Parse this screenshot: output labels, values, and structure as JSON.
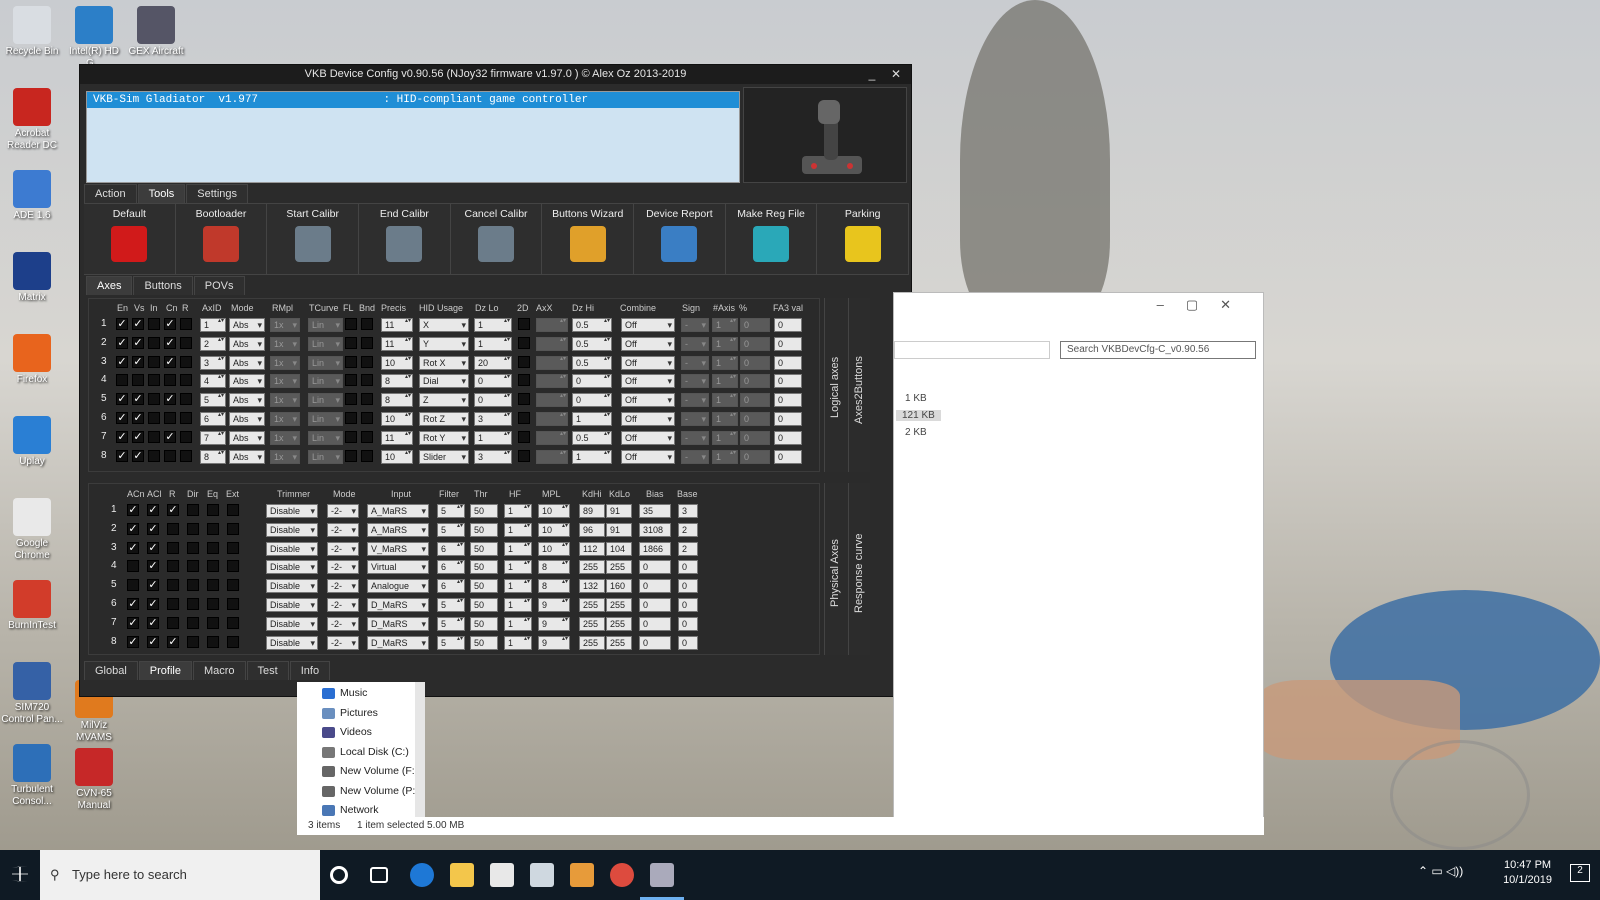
{
  "desktop": {
    "icons_col1": [
      "Recycle Bin",
      "Acrobat Reader DC",
      "ADE 1.6",
      "Matrix",
      "Firefox",
      "Uplay",
      "Google Chrome",
      "BurnInTest",
      "SIM720 Control Pan...",
      "Turbulent Consol..."
    ],
    "icons_col2": [
      "Intel(R) HD G...",
      "GEX Aircraft",
      "MilViz MVAMS",
      "CVN-65 Manual"
    ]
  },
  "vkb": {
    "title": "VKB Device Config v0.90.56 (NJoy32 firmware v1.97.0 ) © Alex Oz 2013-2019",
    "minimize": "_",
    "close": "✕",
    "device_row": "VKB-Sim Gladiator  v1.977                   : HID-compliant game controller",
    "top_tabs": [
      "Action",
      "Tools",
      "Settings"
    ],
    "tools": [
      "Default",
      "Bootloader",
      "Start Calibr",
      "End Calibr",
      "Cancel Calibr",
      "Buttons Wizard",
      "Device Report",
      "Make Reg File",
      "Parking"
    ],
    "sub_tabs": [
      "Axes",
      "Buttons",
      "POVs"
    ],
    "logical": {
      "headers": [
        "En",
        "Vs",
        "In",
        "Cn",
        "R",
        "AxID",
        "Mode",
        "RMpl",
        "TCurve",
        "FL",
        "Bnd",
        "Precis",
        "HID Usage",
        "Dz Lo",
        "2D",
        "AxX",
        "Dz Hi",
        "Combine",
        "Sign",
        "#Axis",
        "%",
        "FA3 val"
      ],
      "side_labels": [
        "Logical axes",
        "Axes2Buttons"
      ],
      "rows": [
        {
          "n": "1",
          "en": "✓",
          "vs": "✓",
          "in": "",
          "cn": "✓",
          "r": "",
          "axid": "1",
          "mode": "Abs",
          "rmpl": "1x",
          "tcurve": "Lin",
          "precis": "11",
          "hid": "X",
          "dzlo": "1",
          "dzhi": "0.5",
          "combine": "Off",
          "sign": "-",
          "axis": "1",
          "pct": "0",
          "fa3": "0"
        },
        {
          "n": "2",
          "en": "✓",
          "vs": "✓",
          "in": "",
          "cn": "✓",
          "r": "",
          "axid": "2",
          "mode": "Abs",
          "rmpl": "1x",
          "tcurve": "Lin",
          "precis": "11",
          "hid": "Y",
          "dzlo": "1",
          "dzhi": "0.5",
          "combine": "Off",
          "sign": "-",
          "axis": "1",
          "pct": "0",
          "fa3": "0"
        },
        {
          "n": "3",
          "en": "✓",
          "vs": "✓",
          "in": "",
          "cn": "✓",
          "r": "",
          "axid": "3",
          "mode": "Abs",
          "rmpl": "1x",
          "tcurve": "Lin",
          "precis": "10",
          "hid": "Rot X",
          "dzlo": "20",
          "dzhi": "0.5",
          "combine": "Off",
          "sign": "-",
          "axis": "1",
          "pct": "0",
          "fa3": "0"
        },
        {
          "n": "4",
          "en": "",
          "vs": "",
          "in": "",
          "cn": "",
          "r": "",
          "axid": "4",
          "mode": "Abs",
          "rmpl": "1x",
          "tcurve": "Lin",
          "precis": "8",
          "hid": "Dial",
          "dzlo": "0",
          "dzhi": "0",
          "combine": "Off",
          "sign": "-",
          "axis": "1",
          "pct": "0",
          "fa3": "0"
        },
        {
          "n": "5",
          "en": "✓",
          "vs": "✓",
          "in": "",
          "cn": "✓",
          "r": "",
          "axid": "5",
          "mode": "Abs",
          "rmpl": "1x",
          "tcurve": "Lin",
          "precis": "8",
          "hid": "Z",
          "dzlo": "0",
          "dzhi": "0",
          "combine": "Off",
          "sign": "-",
          "axis": "1",
          "pct": "0",
          "fa3": "0"
        },
        {
          "n": "6",
          "en": "✓",
          "vs": "✓",
          "in": "",
          "cn": "",
          "r": "",
          "axid": "6",
          "mode": "Abs",
          "rmpl": "1x",
          "tcurve": "Lin",
          "precis": "10",
          "hid": "Rot Z",
          "dzlo": "3",
          "dzhi": "1",
          "combine": "Off",
          "sign": "-",
          "axis": "1",
          "pct": "0",
          "fa3": "0"
        },
        {
          "n": "7",
          "en": "✓",
          "vs": "✓",
          "in": "",
          "cn": "✓",
          "r": "",
          "axid": "7",
          "mode": "Abs",
          "rmpl": "1x",
          "tcurve": "Lin",
          "precis": "11",
          "hid": "Rot Y",
          "dzlo": "1",
          "dzhi": "0.5",
          "combine": "Off",
          "sign": "-",
          "axis": "1",
          "pct": "0",
          "fa3": "0"
        },
        {
          "n": "8",
          "en": "✓",
          "vs": "✓",
          "in": "",
          "cn": "",
          "r": "",
          "axid": "8",
          "mode": "Abs",
          "rmpl": "1x",
          "tcurve": "Lin",
          "precis": "10",
          "hid": "Slider",
          "dzlo": "3",
          "dzhi": "1",
          "combine": "Off",
          "sign": "-",
          "axis": "1",
          "pct": "0",
          "fa3": "0"
        }
      ]
    },
    "physical": {
      "headers": [
        "ACn",
        "ACl",
        "R",
        "Dir",
        "Eq",
        "Ext",
        "Trimmer",
        "Mode",
        "Input",
        "Filter",
        "Thr",
        "HF",
        "MPL",
        "KdHi",
        "KdLo",
        "Bias",
        "Base"
      ],
      "side_labels": [
        "Physical Axes",
        "Response curve"
      ],
      "rows": [
        {
          "n": "1",
          "acn": "✓",
          "acl": "✓",
          "r": "✓",
          "trimmer": "Disable",
          "mode": "-2-",
          "input": "A_MaRS",
          "filter": "5",
          "thr": "50",
          "hf": "1",
          "mpl": "10",
          "kdhi": "89",
          "kdlo": "91",
          "bias": "35",
          "base": "3"
        },
        {
          "n": "2",
          "acn": "✓",
          "acl": "✓",
          "r": "",
          "trimmer": "Disable",
          "mode": "-2-",
          "input": "A_MaRS",
          "filter": "5",
          "thr": "50",
          "hf": "1",
          "mpl": "10",
          "kdhi": "96",
          "kdlo": "91",
          "bias": "3108",
          "base": "2"
        },
        {
          "n": "3",
          "acn": "✓",
          "acl": "✓",
          "r": "",
          "trimmer": "Disable",
          "mode": "-2-",
          "input": "V_MaRS",
          "filter": "6",
          "thr": "50",
          "hf": "1",
          "mpl": "10",
          "kdhi": "112",
          "kdlo": "104",
          "bias": "1866",
          "base": "2"
        },
        {
          "n": "4",
          "acn": "",
          "acl": "✓",
          "r": "",
          "trimmer": "Disable",
          "mode": "-2-",
          "input": "Virtual",
          "filter": "6",
          "thr": "50",
          "hf": "1",
          "mpl": "8",
          "kdhi": "255",
          "kdlo": "255",
          "bias": "0",
          "base": "0"
        },
        {
          "n": "5",
          "acn": "",
          "acl": "✓",
          "r": "",
          "trimmer": "Disable",
          "mode": "-2-",
          "input": "Analogue",
          "filter": "6",
          "thr": "50",
          "hf": "1",
          "mpl": "8",
          "kdhi": "132",
          "kdlo": "160",
          "bias": "0",
          "base": "0"
        },
        {
          "n": "6",
          "acn": "✓",
          "acl": "✓",
          "r": "",
          "trimmer": "Disable",
          "mode": "-2-",
          "input": "D_MaRS",
          "filter": "5",
          "thr": "50",
          "hf": "1",
          "mpl": "9",
          "kdhi": "255",
          "kdlo": "255",
          "bias": "0",
          "base": "0"
        },
        {
          "n": "7",
          "acn": "✓",
          "acl": "✓",
          "r": "",
          "trimmer": "Disable",
          "mode": "-2-",
          "input": "D_MaRS",
          "filter": "5",
          "thr": "50",
          "hf": "1",
          "mpl": "9",
          "kdhi": "255",
          "kdlo": "255",
          "bias": "0",
          "base": "0"
        },
        {
          "n": "8",
          "acn": "✓",
          "acl": "✓",
          "r": "✓",
          "trimmer": "Disable",
          "mode": "-2-",
          "input": "D_MaRS",
          "filter": "5",
          "thr": "50",
          "hf": "1",
          "mpl": "9",
          "kdhi": "255",
          "kdlo": "255",
          "bias": "0",
          "base": "0"
        }
      ]
    },
    "bottom_tabs": [
      "Global",
      "Profile",
      "Macro",
      "Test",
      "Info"
    ]
  },
  "explorer": {
    "search_placeholder": "Search VKBDevCfg-C_v0.90.56",
    "sizes": [
      "1 KB",
      "121 KB",
      "2 KB"
    ],
    "nav": [
      "Music",
      "Pictures",
      "Videos",
      "Local Disk (C:)",
      "New Volume (F:)",
      "New Volume (P:)",
      "Network"
    ],
    "status_items": "3 items",
    "status_selected": "1 item selected  5.00 MB"
  },
  "taskbar": {
    "search_placeholder": "Type here to search",
    "time": "10:47 PM",
    "date": "10/1/2019",
    "notif_count": "2"
  },
  "colors": {
    "accent": "#1f8ed6",
    "window_bg": "#2b2b2b",
    "taskbar": "#0f1a24"
  }
}
